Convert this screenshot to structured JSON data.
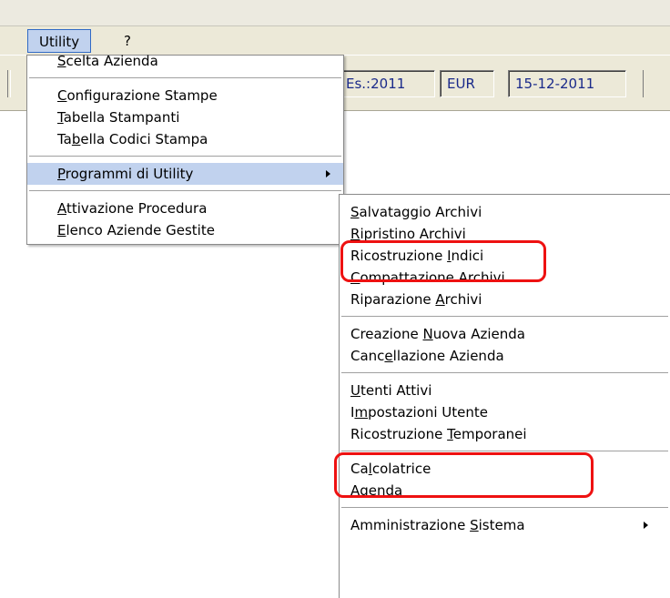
{
  "menubar": {
    "utility": "Utility",
    "help": "?"
  },
  "toolbar": {
    "esercizio": "Es.:2011",
    "valuta": "EUR",
    "data": "15-12-2011"
  },
  "utility_menu": [
    {
      "pre": "",
      "u": "S",
      "post": "celta Azienda"
    },
    {
      "pre": "",
      "u": "C",
      "post": "onfigurazione Stampe"
    },
    {
      "pre": "",
      "u": "T",
      "post": "abella Stampanti"
    },
    {
      "pre": "Ta",
      "u": "b",
      "post": "ella Codici Stampa"
    },
    {
      "pre": "",
      "u": "P",
      "post": "rogrammi di Utility"
    },
    {
      "pre": "",
      "u": "A",
      "post": "ttivazione Procedura"
    },
    {
      "pre": "",
      "u": "E",
      "post": "lenco Aziende Gestite"
    }
  ],
  "submenu": [
    {
      "pre": "",
      "u": "S",
      "post": "alvataggio Archivi"
    },
    {
      "pre": "",
      "u": "R",
      "post": "ipristino Archivi"
    },
    {
      "pre": "Ricostruzione ",
      "u": "I",
      "post": "ndici"
    },
    {
      "pre": "",
      "u": "C",
      "post": "ompattazione Archivi"
    },
    {
      "pre": "Riparazione ",
      "u": "A",
      "post": "rchivi"
    },
    {
      "pre": "Creazione ",
      "u": "N",
      "post": "uova Azienda"
    },
    {
      "pre": "Canc",
      "u": "e",
      "post": "llazione Azienda"
    },
    {
      "pre": "",
      "u": "U",
      "post": "tenti Attivi"
    },
    {
      "pre": "I",
      "u": "m",
      "post": "postazioni Utente"
    },
    {
      "pre": "Ricostruzione ",
      "u": "T",
      "post": "emporanei"
    },
    {
      "pre": "Ca",
      "u": "l",
      "post": "colatrice"
    },
    {
      "pre": "A",
      "u": "g",
      "post": "enda"
    },
    {
      "pre": "Amministrazione ",
      "u": "S",
      "post": "istema"
    }
  ],
  "highlight_color": "#ee1111"
}
